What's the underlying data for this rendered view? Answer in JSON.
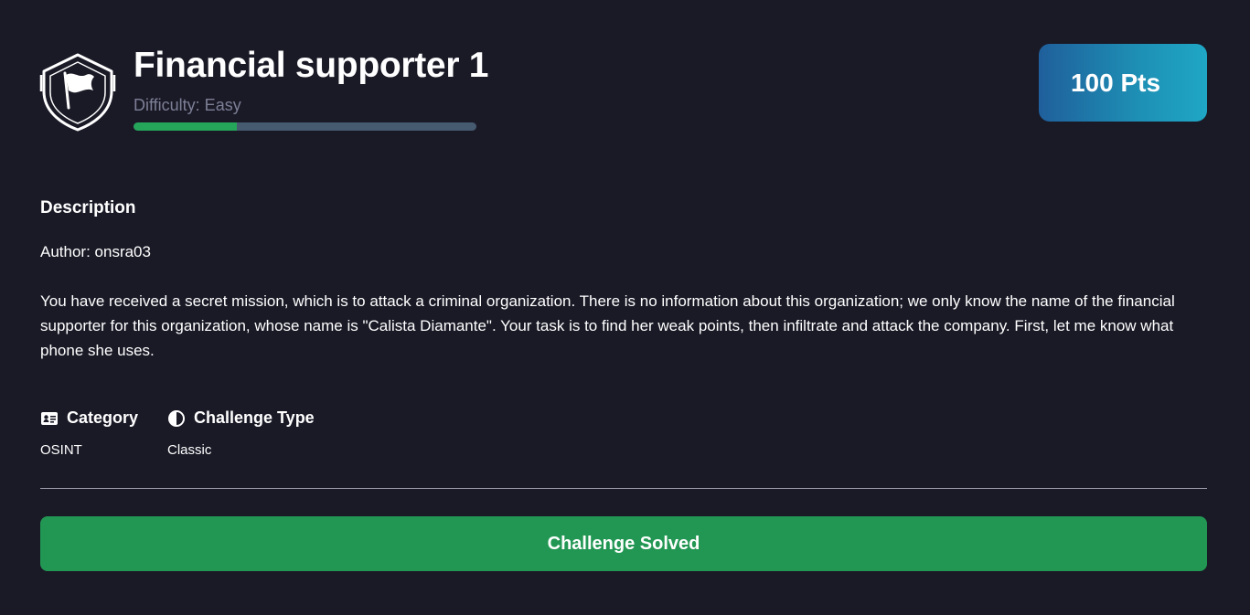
{
  "challenge": {
    "title": "Financial supporter 1",
    "difficulty_label": "Difficulty: Easy",
    "difficulty_progress": 0.3,
    "points_label": "100 Pts",
    "icon": "shield-flag-icon"
  },
  "description": {
    "heading": "Description",
    "author": "Author: onsra03",
    "body": "You have received a secret mission, which is to attack a criminal organization. There is no information about this organization; we only know the name of the financial supporter for this organization, whose name is \"Calista Diamante\". Your task is to find her weak points, then infiltrate and attack the company. First, let me know what phone she uses."
  },
  "meta": {
    "category": {
      "label": "Category",
      "value": "OSINT",
      "icon": "id-card-icon"
    },
    "challenge_type": {
      "label": "Challenge Type",
      "value": "Classic",
      "icon": "half-circle-icon"
    }
  },
  "action": {
    "solved_label": "Challenge Solved"
  },
  "colors": {
    "background": "#1a1a27",
    "progress_fill": "#25a55a",
    "progress_track": "#465a70",
    "badge_gradient_start": "#1f5f9b",
    "badge_gradient_end": "#1fa7c5",
    "solved_button": "#229753"
  }
}
